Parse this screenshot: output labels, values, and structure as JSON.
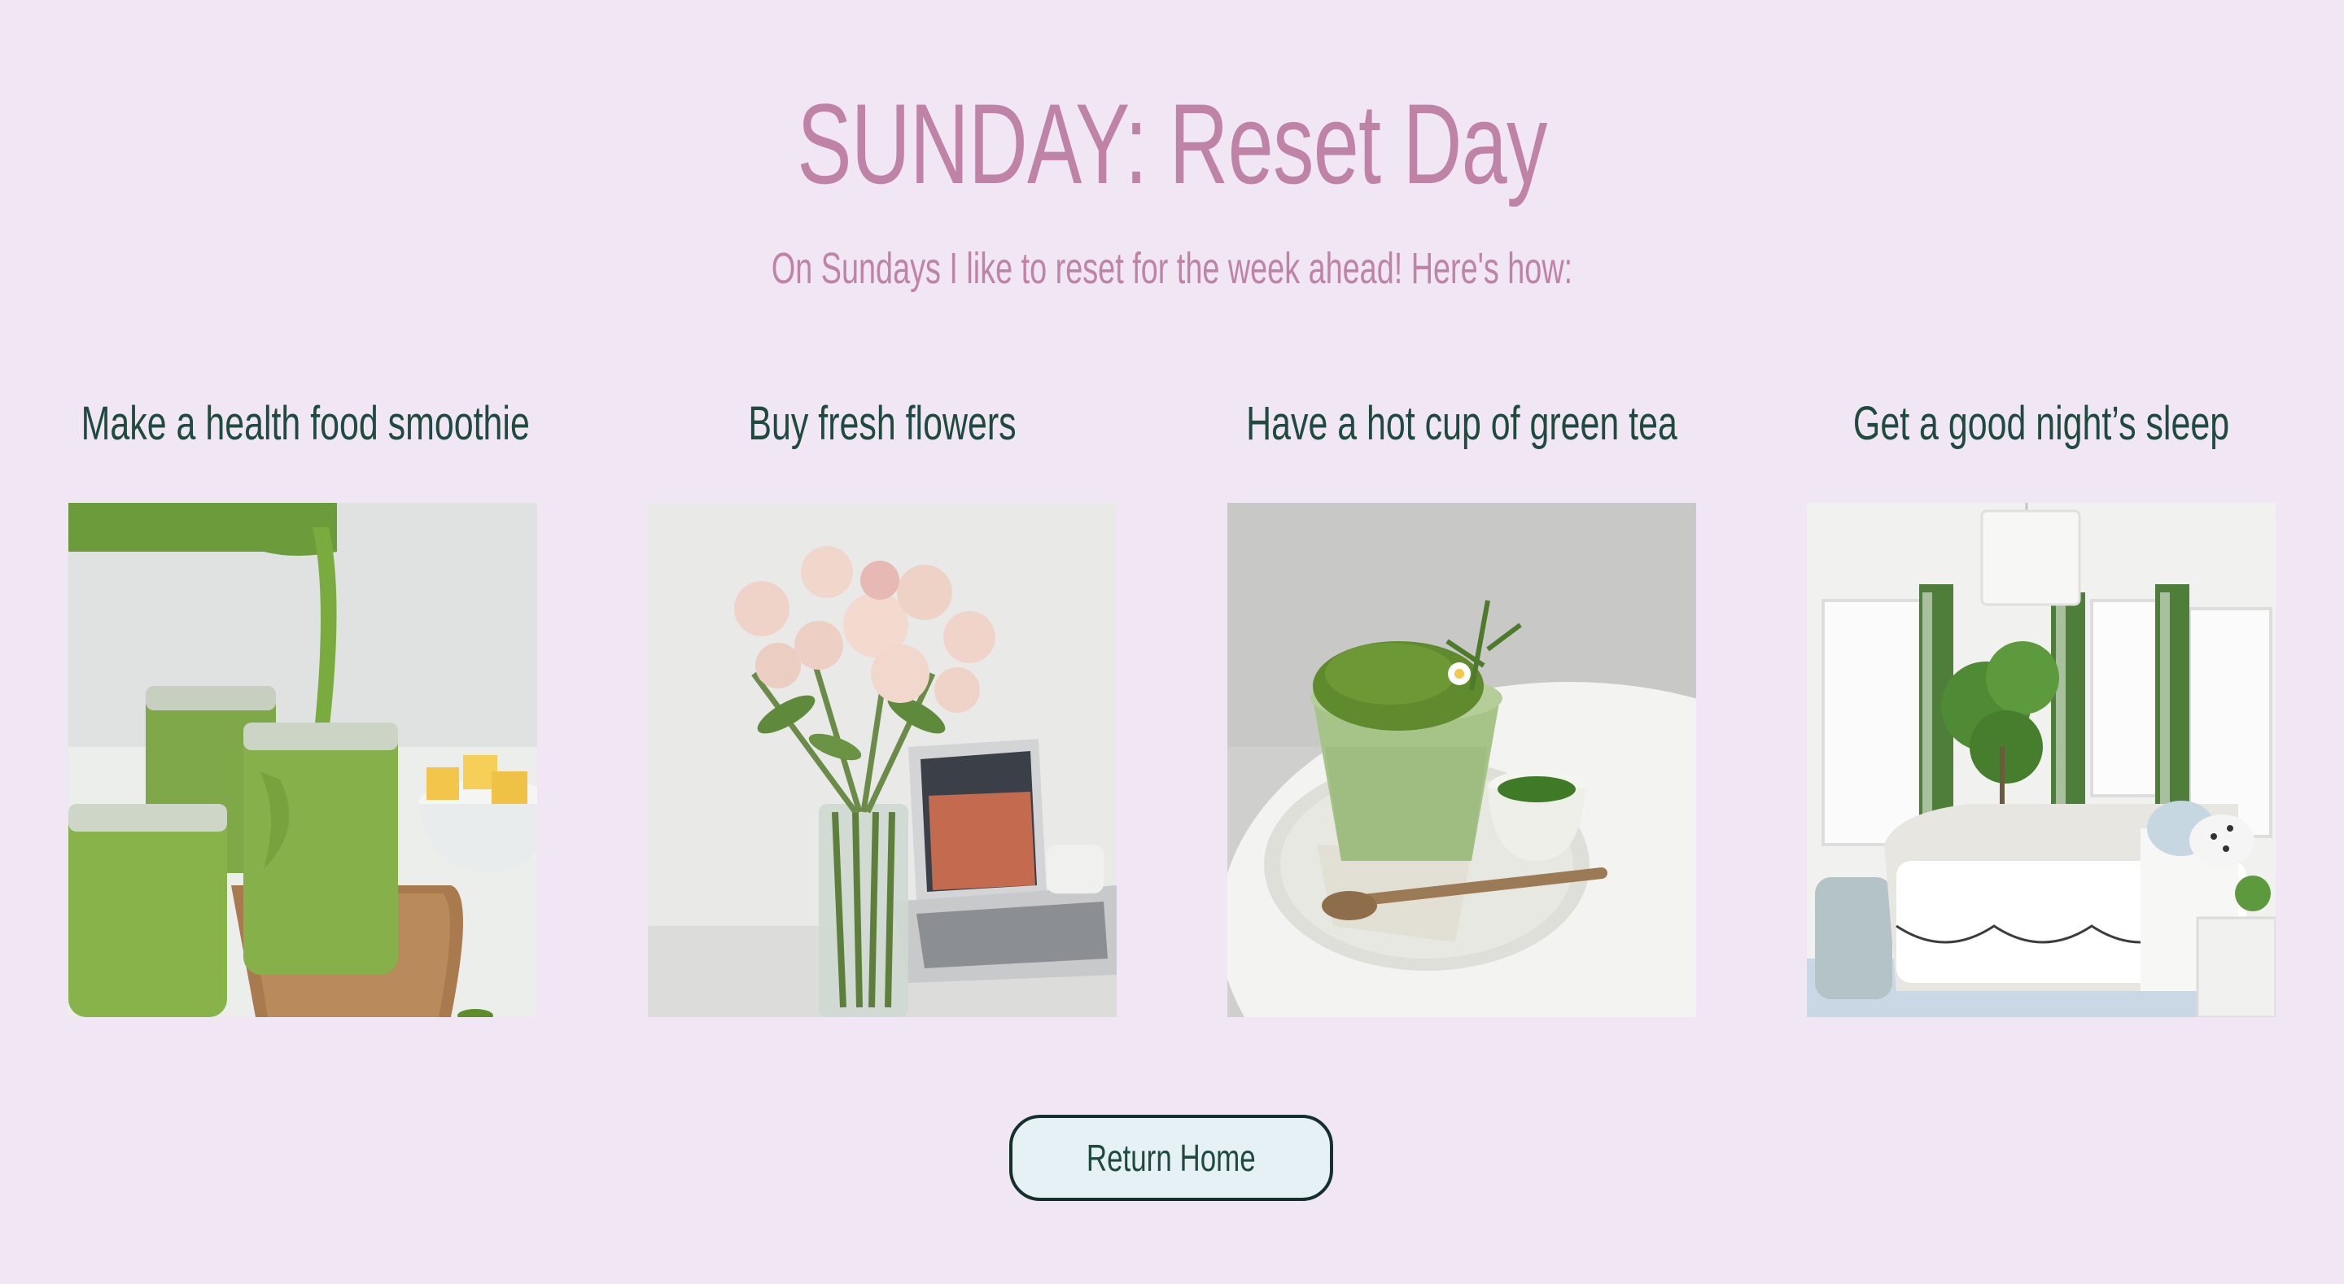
{
  "page": {
    "title": "SUNDAY: Reset Day",
    "subtitle": "On Sundays I like to reset for the week ahead! Here's how:"
  },
  "cards": [
    {
      "label": "Make a health food smoothie"
    },
    {
      "label": "Buy fresh flowers"
    },
    {
      "label": "Have a hot cup of green tea"
    },
    {
      "label": "Get a good night’s sleep"
    }
  ],
  "actions": {
    "return_home": "Return Home"
  },
  "colors": {
    "background": "#f0e6f4",
    "title": "#c083a8",
    "heading": "#1f4a3f",
    "button_bg": "#e6f1f5",
    "button_border": "#14302a"
  }
}
